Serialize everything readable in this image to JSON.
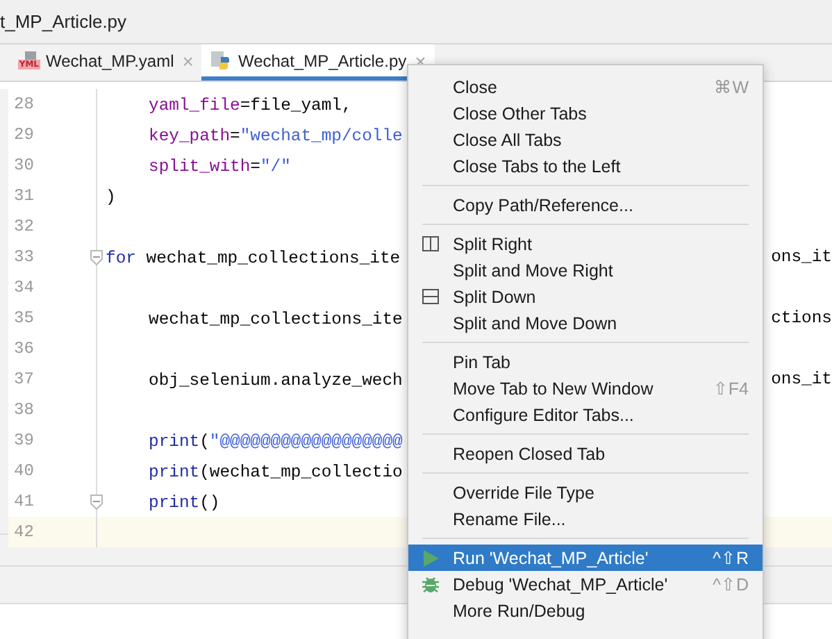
{
  "window": {
    "title": "t_MP_Article.py"
  },
  "tabs": [
    {
      "label": "Wechat_MP.yaml",
      "kind": "yaml",
      "badge": "YML",
      "selected": false,
      "close": "×"
    },
    {
      "label": "Wechat_MP_Article.py",
      "kind": "python",
      "selected": true,
      "close": "×"
    }
  ],
  "editor": {
    "lines": [
      {
        "number": "28",
        "current": false,
        "indented": true,
        "segments": [
          {
            "kind": "param",
            "text": "yaml_file"
          },
          {
            "kind": "plain",
            "text": "=file_yaml,"
          }
        ]
      },
      {
        "number": "29",
        "current": false,
        "indented": true,
        "segments": [
          {
            "kind": "param",
            "text": "key_path"
          },
          {
            "kind": "plain",
            "text": "="
          },
          {
            "kind": "string",
            "text": "\"wechat_mp/colle"
          }
        ]
      },
      {
        "number": "30",
        "current": false,
        "indented": true,
        "segments": [
          {
            "kind": "param",
            "text": "split_with"
          },
          {
            "kind": "plain",
            "text": "="
          },
          {
            "kind": "string",
            "text": "\"/\""
          }
        ]
      },
      {
        "number": "31",
        "current": false,
        "indented": false,
        "segments": [
          {
            "kind": "plain",
            "text": ")"
          }
        ]
      },
      {
        "number": "32",
        "current": false
      },
      {
        "number": "33",
        "current": false,
        "indented": false,
        "fold": true,
        "segments": [
          {
            "kind": "keyword",
            "text": "for"
          },
          {
            "kind": "plain",
            "text": " wechat_mp_collections_ite"
          }
        ],
        "right": "ons_it"
      },
      {
        "number": "34",
        "current": false
      },
      {
        "number": "35",
        "current": false,
        "indented": true,
        "segments": [
          {
            "kind": "plain",
            "text": "wechat_mp_collections_ite"
          }
        ],
        "right": "ctions"
      },
      {
        "number": "36",
        "current": false
      },
      {
        "number": "37",
        "current": false,
        "indented": true,
        "segments": [
          {
            "kind": "plain",
            "text": "obj_selenium.analyze_wech"
          }
        ],
        "right": "ons_it"
      },
      {
        "number": "38",
        "current": false
      },
      {
        "number": "39",
        "current": false,
        "indented": true,
        "segments": [
          {
            "kind": "keyword",
            "text": "print"
          },
          {
            "kind": "plain",
            "text": "("
          },
          {
            "kind": "string",
            "text": "\"@@@@@@@@@@@@@@@@@@"
          }
        ]
      },
      {
        "number": "40",
        "current": false,
        "indented": true,
        "segments": [
          {
            "kind": "keyword",
            "text": "print"
          },
          {
            "kind": "plain",
            "text": "(wechat_mp_collectio"
          }
        ]
      },
      {
        "number": "41",
        "current": false,
        "indented": true,
        "fold": true,
        "segments": [
          {
            "kind": "keyword",
            "text": "print"
          },
          {
            "kind": "plain",
            "text": "()"
          }
        ]
      },
      {
        "number": "42",
        "current": true
      }
    ]
  },
  "context_menu": {
    "sections": [
      {
        "items": [
          {
            "label": "Close",
            "shortcut": "⌘W",
            "selected": false
          },
          {
            "label": "Close Other Tabs",
            "selected": false
          },
          {
            "label": "Close All Tabs",
            "selected": false
          },
          {
            "label": "Close Tabs to the Left",
            "selected": false
          }
        ]
      },
      {
        "items": [
          {
            "label": "Copy Path/Reference...",
            "selected": false
          }
        ]
      },
      {
        "items": [
          {
            "label": "Split Right",
            "kind": "split-right",
            "selected": false
          },
          {
            "label": "Split and Move Right",
            "selected": false
          },
          {
            "label": "Split Down",
            "kind": "split-down",
            "selected": false
          },
          {
            "label": "Split and Move Down",
            "selected": false
          }
        ]
      },
      {
        "items": [
          {
            "label": "Pin Tab",
            "selected": false
          },
          {
            "label": "Move Tab to New Window",
            "shortcut": "⇧F4",
            "selected": false
          },
          {
            "label": "Configure Editor Tabs...",
            "selected": false
          }
        ]
      },
      {
        "items": [
          {
            "label": "Reopen Closed Tab",
            "selected": false
          }
        ]
      },
      {
        "items": [
          {
            "label": "Override File Type",
            "selected": false
          },
          {
            "label": "Rename File...",
            "selected": false
          }
        ]
      },
      {
        "items": [
          {
            "label": "Run 'Wechat_MP_Article'",
            "kind": "run",
            "shortcut": "^⇧R",
            "selected": true
          },
          {
            "label": "Debug 'Wechat_MP_Article'",
            "kind": "debug",
            "shortcut": "^⇧D",
            "selected": false
          },
          {
            "label": "More Run/Debug",
            "selected": false
          }
        ]
      }
    ]
  }
}
